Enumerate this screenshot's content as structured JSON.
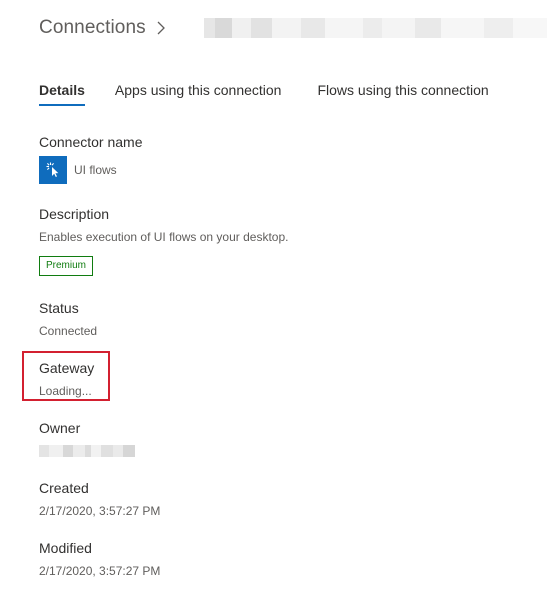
{
  "breadcrumb": {
    "root": "Connections"
  },
  "tabs": [
    {
      "label": "Details",
      "active": true
    },
    {
      "label": "Apps using this connection",
      "active": false
    },
    {
      "label": "Flows using this connection",
      "active": false
    }
  ],
  "fields": {
    "connector": {
      "label": "Connector name",
      "value": "UI flows",
      "icon": "cursor-click-icon",
      "icon_color": "#0f6cbd"
    },
    "description": {
      "label": "Description",
      "value": "Enables execution of UI flows on your desktop.",
      "badge": "Premium",
      "badge_color": "#107c10"
    },
    "status": {
      "label": "Status",
      "value": "Connected"
    },
    "gateway": {
      "label": "Gateway",
      "value": "Loading...",
      "highlight_color": "#d32030"
    },
    "owner": {
      "label": "Owner"
    },
    "created": {
      "label": "Created",
      "value": "2/17/2020, 3:57:27 PM"
    },
    "modified": {
      "label": "Modified",
      "value": "2/17/2020, 3:57:27 PM"
    }
  }
}
